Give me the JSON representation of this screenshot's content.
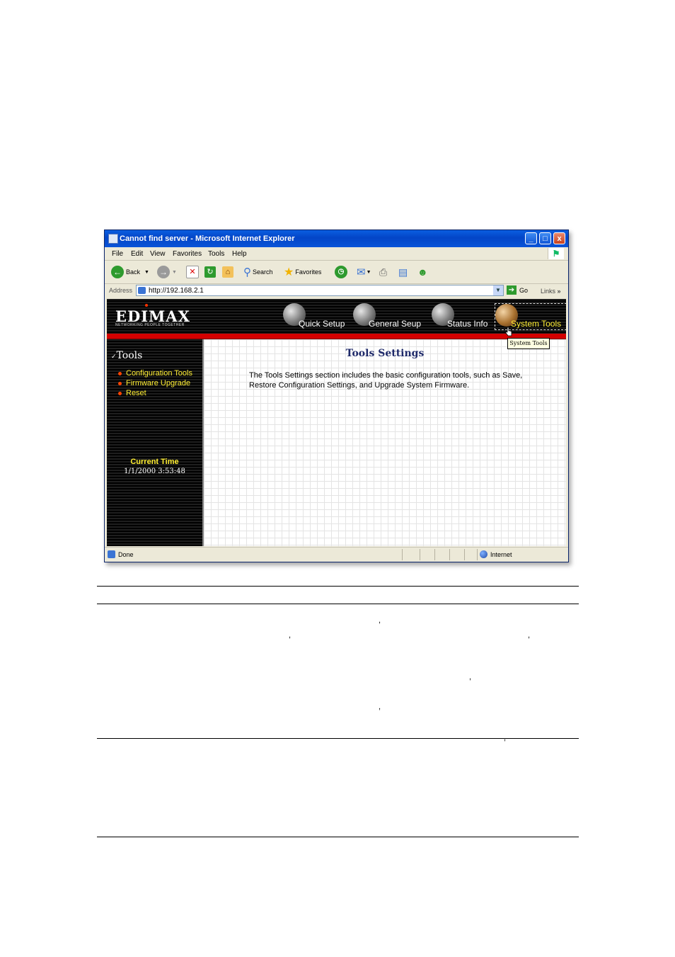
{
  "window": {
    "title": "Cannot find server - Microsoft Internet Explorer",
    "buttons": {
      "minimize": "_",
      "maximize": "□",
      "close": "x"
    }
  },
  "menu": [
    "File",
    "Edit",
    "View",
    "Favorites",
    "Tools",
    "Help"
  ],
  "toolbar": {
    "back": "Back",
    "search": "Search",
    "favorites": "Favorites"
  },
  "address": {
    "label": "Address",
    "url": "http://192.168.2.1",
    "go": "Go",
    "links": "Links"
  },
  "logo": {
    "text": "EDIMAX",
    "tagline": "NETWORKING PEOPLE TOGETHER"
  },
  "nav": [
    {
      "label": "Quick Setup"
    },
    {
      "label": "General Seup"
    },
    {
      "label": "Status Info"
    },
    {
      "label": "System Tools",
      "active": true
    }
  ],
  "tooltip": "System Tools",
  "sidebar": {
    "title": "Tools",
    "items": [
      "Configuration Tools",
      "Firmware Upgrade",
      "Reset"
    ],
    "current_time_label": "Current Time",
    "current_time_value": "1/1/2000 3:53:48"
  },
  "content": {
    "title": "Tools Settings",
    "body": "The Tools Settings section includes the basic configuration tools, such as Save, Restore Configuration Settings, and Upgrade System Firmware."
  },
  "status": {
    "left": "Done",
    "zone": "Internet"
  },
  "doc_marks": [
    ",",
    ",",
    ",",
    ",",
    ",",
    ","
  ]
}
